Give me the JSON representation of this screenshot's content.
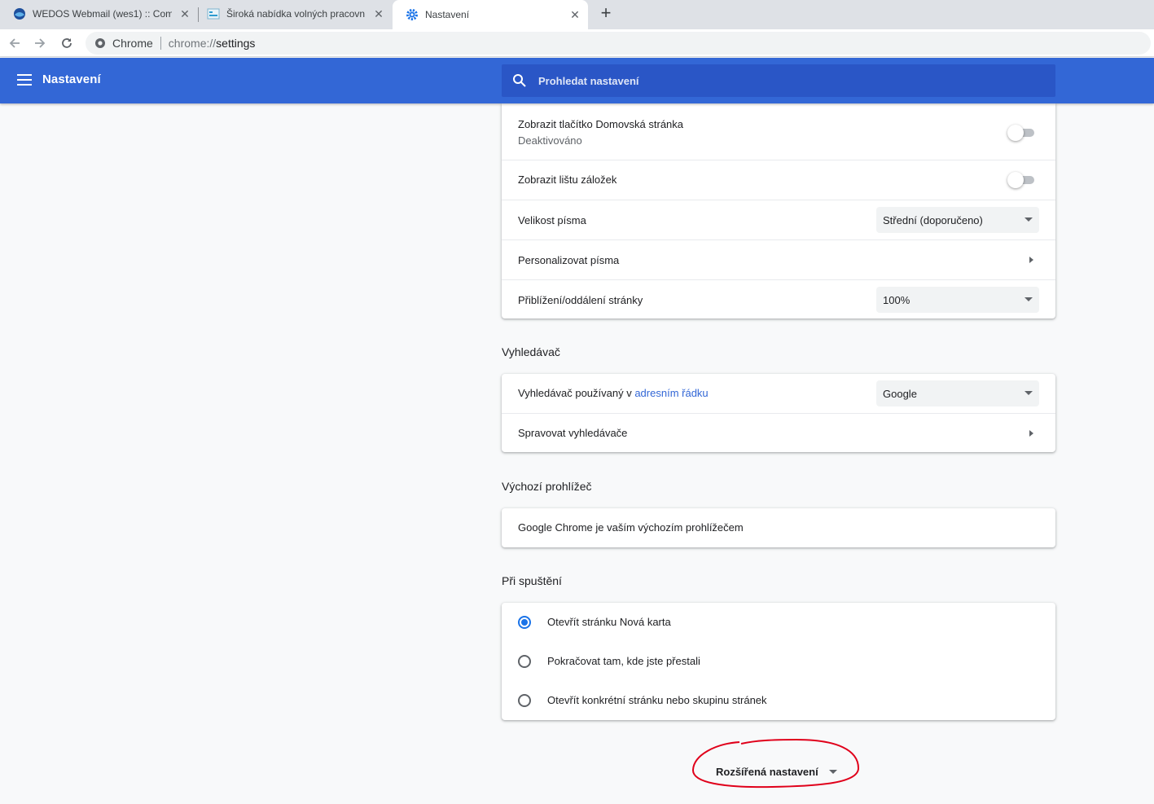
{
  "tabs": [
    {
      "title": "WEDOS Webmail (wes1) :: Compo",
      "favicon": "wedos-icon",
      "active": false
    },
    {
      "title": "Široká nabídka volných pracovníc",
      "favicon": "jobs-site-icon",
      "active": false
    },
    {
      "title": "Nastavení",
      "favicon": "gear-icon",
      "active": true
    }
  ],
  "toolbar": {
    "omnibox_label": "Chrome",
    "url_scheme": "chrome://",
    "url_host": "settings"
  },
  "header": {
    "title": "Nastavení",
    "search_placeholder": "Prohledat nastavení"
  },
  "appearance": {
    "home_button_label": "Zobrazit tlačítko Domovská stránka",
    "home_button_status": "Deaktivováno",
    "bookmarks_bar_label": "Zobrazit lištu záložek",
    "font_size_label": "Velikost písma",
    "font_size_value": "Střední (doporučeno)",
    "customize_fonts_label": "Personalizovat písma",
    "zoom_label": "Přiblížení/oddálení stránky",
    "zoom_value": "100%"
  },
  "search_engine": {
    "title": "Vyhledávač",
    "engine_label_prefix": "Vyhledávač používaný v ",
    "engine_label_link": "adresním řádku",
    "engine_value": "Google",
    "manage_label": "Spravovat vyhledávače"
  },
  "default_browser": {
    "title": "Výchozí prohlížeč",
    "status": "Google Chrome je vaším výchozím prohlížečem"
  },
  "on_startup": {
    "title": "Při spuštění",
    "options": [
      {
        "label": "Otevřít stránku Nová karta",
        "checked": true
      },
      {
        "label": "Pokračovat tam, kde jste přestali",
        "checked": false
      },
      {
        "label": "Otevřít konkrétní stránku nebo skupinu stránek",
        "checked": false
      }
    ]
  },
  "advanced_label": "Rozšířená nastavení",
  "colors": {
    "header": "#3367d6",
    "search_bg": "#2a56c6",
    "accent": "#1a73e8",
    "annotation": "#e0001a"
  }
}
